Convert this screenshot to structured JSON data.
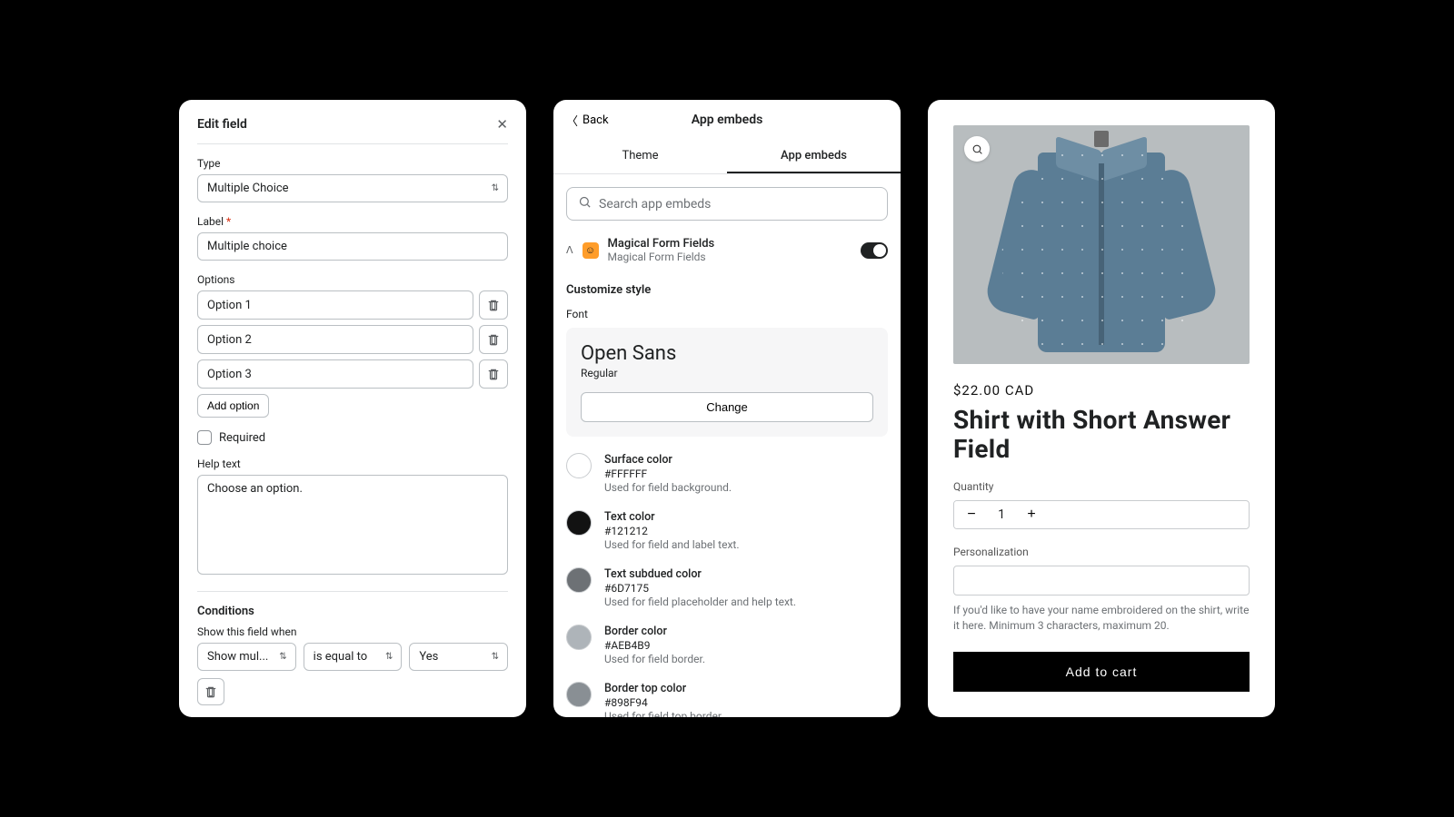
{
  "panel1": {
    "title": "Edit field",
    "type_label": "Type",
    "type_value": "Multiple Choice",
    "label_label": "Label",
    "label_value": "Multiple choice",
    "options_label": "Options",
    "options": [
      "Option 1",
      "Option 2",
      "Option 3"
    ],
    "add_option": "Add option",
    "required_label": "Required",
    "help_text_label": "Help text",
    "help_text_value": "Choose an option.",
    "conditions_title": "Conditions",
    "show_when_label": "Show this field when",
    "cond_field": "Show mul...",
    "cond_op": "is equal to",
    "cond_value": "Yes"
  },
  "panel2": {
    "back": "Back",
    "title": "App embeds",
    "tabs": {
      "theme": "Theme",
      "app": "App embeds"
    },
    "search_placeholder": "Search app embeds",
    "embed": {
      "name": "Magical Form Fields",
      "sub": "Magical Form Fields"
    },
    "customize_title": "Customize style",
    "font_label": "Font",
    "font_name": "Open Sans",
    "font_weight": "Regular",
    "change": "Change",
    "colors": [
      {
        "name": "Surface color",
        "hex": "#FFFFFF",
        "desc": "Used for field background."
      },
      {
        "name": "Text color",
        "hex": "#121212",
        "desc": "Used for field and label text."
      },
      {
        "name": "Text subdued color",
        "hex": "#6D7175",
        "desc": "Used for field placeholder and help text."
      },
      {
        "name": "Border color",
        "hex": "#AEB4B9",
        "desc": "Used for field border."
      },
      {
        "name": "Border top color",
        "hex": "#898F94",
        "desc": "Used for field top border."
      }
    ]
  },
  "panel3": {
    "price": "$22.00 CAD",
    "title": "Shirt with Short Answer Field",
    "quantity_label": "Quantity",
    "quantity_value": "1",
    "personalization_label": "Personalization",
    "personalization_help": "If you'd like to have your name embroidered on the shirt, write it here. Minimum 3 characters, maximum 20.",
    "add_to_cart": "Add to cart"
  }
}
